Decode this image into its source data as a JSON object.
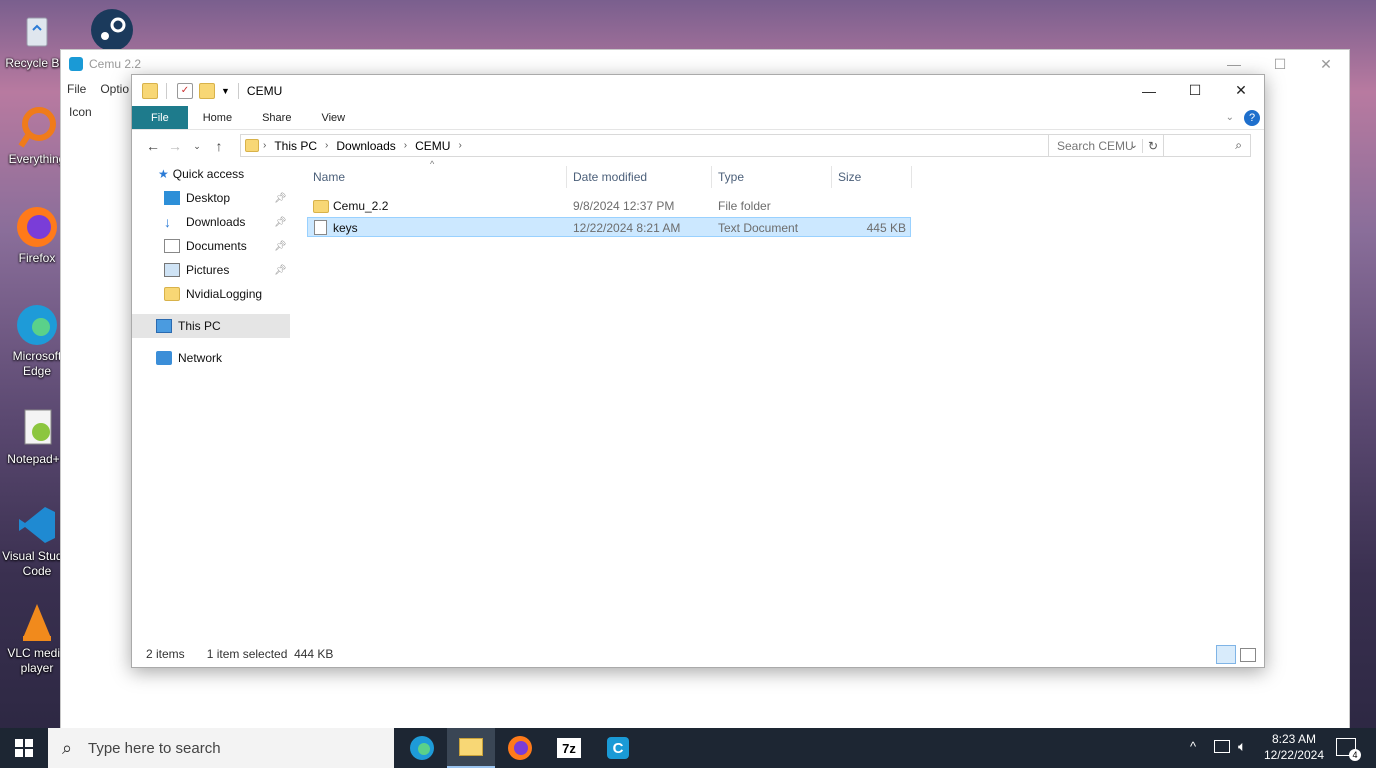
{
  "desktop": {
    "icons": [
      {
        "label": "Recycle Bin",
        "icon": "recycle-bin-icon"
      },
      {
        "label": "Everything",
        "icon": "everything-icon"
      },
      {
        "label": "Firefox",
        "icon": "firefox-icon"
      },
      {
        "label": "Microsoft Edge",
        "icon": "edge-icon"
      },
      {
        "label": "Notepad++",
        "icon": "notepadpp-icon"
      },
      {
        "label": "Visual Studio Code",
        "icon": "vscode-icon"
      },
      {
        "label": "VLC media player",
        "icon": "vlc-icon"
      }
    ],
    "steam_icon": "steam-icon"
  },
  "cemu_window": {
    "title": "Cemu 2.2",
    "menu": [
      "File",
      "Optio"
    ],
    "list_header": "Icon"
  },
  "explorer": {
    "title": "CEMU",
    "ribbon_tabs": [
      "File",
      "Home",
      "Share",
      "View"
    ],
    "breadcrumb": [
      "This PC",
      "Downloads",
      "CEMU"
    ],
    "search_placeholder": "Search CEMU",
    "nav": {
      "quick_access": "Quick access",
      "pinned": [
        "Desktop",
        "Downloads",
        "Documents",
        "Pictures"
      ],
      "other": "NvidiaLogging",
      "this_pc": "This PC",
      "network": "Network"
    },
    "columns": [
      "Name",
      "Date modified",
      "Type",
      "Size"
    ],
    "files": [
      {
        "name": "Cemu_2.2",
        "date": "9/8/2024 12:37 PM",
        "type": "File folder",
        "size": ""
      },
      {
        "name": "keys",
        "date": "12/22/2024 8:21 AM",
        "type": "Text Document",
        "size": "445 KB"
      }
    ],
    "status": {
      "items": "2 items",
      "selected": "1 item selected  444 KB"
    }
  },
  "taskbar": {
    "search_placeholder": "Type here to search",
    "apps": [
      "edge-icon",
      "file-explorer-icon",
      "firefox-icon",
      "7zip-icon",
      "cemu-icon"
    ],
    "time": "8:23 AM",
    "date": "12/22/2024",
    "notifications": "4",
    "sevenzip_label": "7z",
    "cemu_label": "C"
  },
  "colors": {
    "ribbon_file": "#1e7b8c",
    "selection": "#cce8ff",
    "taskbar": "#1d2633"
  }
}
